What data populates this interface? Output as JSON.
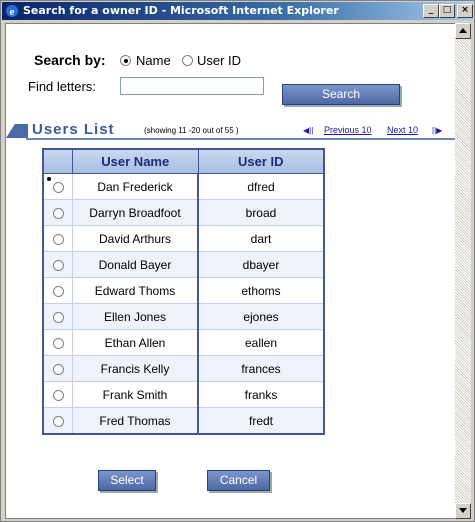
{
  "window": {
    "title": "Search for a owner ID - Microsoft Internet Explorer",
    "controls": [
      "minimize-icon",
      "maximize-icon",
      "close-icon"
    ]
  },
  "search": {
    "by_label": "Search by:",
    "option_name": "Name",
    "option_userid": "User ID",
    "selected": "Name",
    "find_label": "Find letters:",
    "find_value": "",
    "search_button": "Search"
  },
  "list": {
    "title": "Users List",
    "showing": "(showing 11 -20 out of 55 )",
    "prev_label": "Previous 10",
    "next_label": "Next 10",
    "columns": [
      "User Name",
      "User ID"
    ],
    "selected_index": 0,
    "rows": [
      {
        "name": "Dan Frederick",
        "id": "dfred"
      },
      {
        "name": "Darryn Broadfoot",
        "id": "broad"
      },
      {
        "name": "David Arthurs",
        "id": "dart"
      },
      {
        "name": "Donald Bayer",
        "id": "dbayer"
      },
      {
        "name": "Edward Thoms",
        "id": "ethoms"
      },
      {
        "name": "Ellen Jones",
        "id": "ejones"
      },
      {
        "name": "Ethan Allen",
        "id": "eallen"
      },
      {
        "name": "Francis Kelly",
        "id": "frances"
      },
      {
        "name": "Frank Smith",
        "id": "franks"
      },
      {
        "name": "Fred Thomas",
        "id": "fredt"
      }
    ]
  },
  "actions": {
    "select": "Select",
    "cancel": "Cancel"
  },
  "colors": {
    "accent": "#3b5a99",
    "button": "#5b76b5",
    "link": "#1a1aa6"
  }
}
